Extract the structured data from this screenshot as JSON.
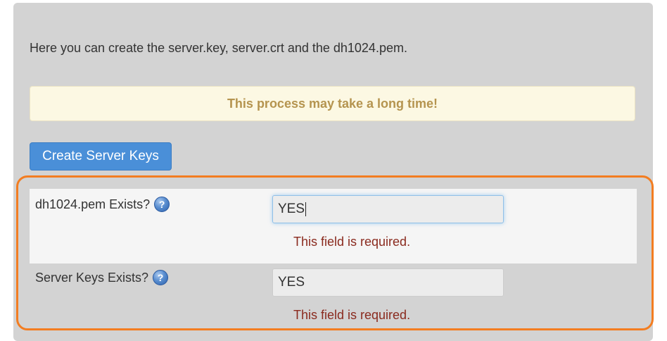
{
  "intro_text": "Here you can create the server.key, server.crt and the dh1024.pem.",
  "warning_text": "This process may take a long time!",
  "create_button_label": "Create Server Keys",
  "help_glyph": "?",
  "fields": [
    {
      "label": "dh1024.pem Exists?",
      "value": "YES",
      "error": "This field is required."
    },
    {
      "label": "Server Keys Exists?",
      "value": "YES",
      "error": "This field is required."
    }
  ],
  "colors": {
    "panel_bg": "#d3d3d3",
    "warning_bg": "#fcf8e3",
    "warning_text": "#b5944f",
    "button_bg": "#4a8fd8",
    "error_text": "#8a2a1e",
    "highlight_border": "#f37d21"
  },
  "icons": {
    "help": "question-circle-icon"
  }
}
